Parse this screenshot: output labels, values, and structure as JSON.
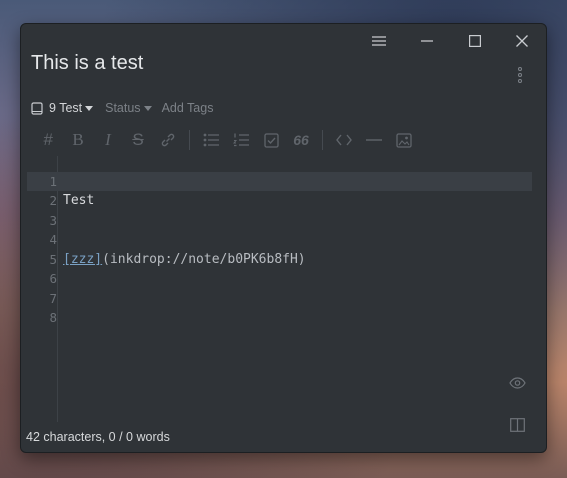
{
  "window": {
    "controls": [
      "menu-icon",
      "minimize-icon",
      "maximize-icon",
      "close-icon"
    ]
  },
  "note": {
    "title": "This is a test",
    "notebook": "9 Test",
    "status": "Status",
    "add_tags": "Add Tags"
  },
  "toolbar": {
    "heading": "#",
    "bold": "B",
    "italic": "I",
    "strike": "S",
    "quote": "66"
  },
  "editor": {
    "lines": [
      {
        "n": "1",
        "text": ""
      },
      {
        "n": "2",
        "text": "Test"
      },
      {
        "n": "3",
        "text": ""
      },
      {
        "n": "4",
        "text": ""
      },
      {
        "n": "5",
        "link_text": "[zzz]",
        "link_url": "(inkdrop://note/b0PK6b8fH)"
      },
      {
        "n": "6",
        "text": ""
      },
      {
        "n": "7",
        "text": ""
      },
      {
        "n": "8",
        "text": ""
      }
    ],
    "active_line": "1"
  },
  "status_bar": {
    "text": "42 characters, 0 / 0 words"
  }
}
